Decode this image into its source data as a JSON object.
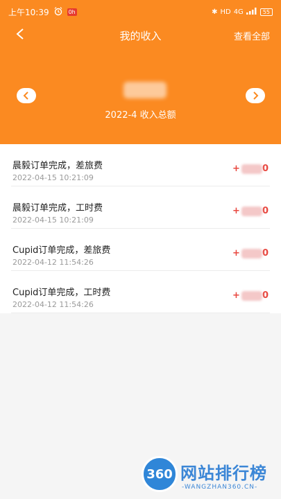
{
  "status_bar": {
    "time": "上午10:39",
    "badge": "0h",
    "bluetooth": "✱",
    "hd": "HD",
    "signal": "4G",
    "battery": "55"
  },
  "nav": {
    "title": "我的收入",
    "view_all": "查看全部"
  },
  "summary": {
    "period": "2022-4 收入总额"
  },
  "records": [
    {
      "title": "晨毅订单完成，差旅费",
      "time": "2022-04-15 10:21:09",
      "sign": "+",
      "tail": "0"
    },
    {
      "title": "晨毅订单完成，工时费",
      "time": "2022-04-15 10:21:09",
      "sign": "+",
      "tail": "0"
    },
    {
      "title": "Cupid订单完成，差旅费",
      "time": "2022-04-12 11:54:26",
      "sign": "+",
      "tail": "0"
    },
    {
      "title": "Cupid订单完成，工时费",
      "time": "2022-04-12 11:54:26",
      "sign": "+",
      "tail": "0"
    }
  ],
  "watermark": {
    "logo_text": "360",
    "title": "网站排行榜",
    "subtitle": "-WANGZHAN360.CN-"
  },
  "colors": {
    "header_orange": "#fb8a21",
    "amount_red": "#e8473f"
  }
}
